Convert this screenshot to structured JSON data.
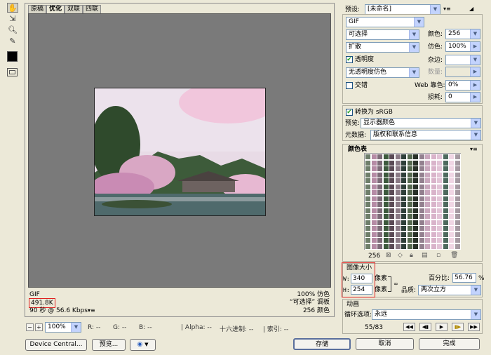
{
  "tabs": [
    "原稿",
    "优化",
    "双联",
    "四联"
  ],
  "info": {
    "format": "GIF",
    "filesize": "491.8K",
    "time": "90 秒 @ 56.6 Kbps",
    "dither_pct": "100% 仿色",
    "palette": "“可选择” 调板",
    "colors": "256  颜色"
  },
  "settings": {
    "preset_label": "预设:",
    "preset_value": "[未命名]",
    "format": "GIF",
    "reduction": "可选择",
    "dither_algo": "扩散",
    "transparency_label": "透明度",
    "matte_dither": "无透明度仿色",
    "interlaced_label": "交错",
    "colors_label": "颜色:",
    "colors_value": "256",
    "dither_label": "仿色:",
    "dither_value": "100%",
    "matte_label": "杂边:",
    "amount_label": "数量:",
    "web_snap_label": "Web 靠色:",
    "web_snap_value": "0%",
    "lossy_label": "损耗:",
    "lossy_value": "0",
    "convert_label": "转换为 sRGB",
    "preview_label": "预览:",
    "preview_value": "显示器颜色",
    "metadata_label": "元数据:",
    "metadata_value": "版权和联系信息"
  },
  "color_table": {
    "title": "颜色表",
    "count": "256"
  },
  "image_size": {
    "title": "图像大小",
    "w_label": "W:",
    "w_value": "340",
    "h_label": "H:",
    "h_value": "254",
    "unit": "像素",
    "percent_label": "百分比:",
    "percent_value": "56.76",
    "percent_unit": "%",
    "quality_label": "品质:",
    "quality_value": "两次立方"
  },
  "animation": {
    "title": "动画",
    "loop_label": "循环选项:",
    "loop_value": "永远",
    "frame": "55/83"
  },
  "statusbar": {
    "zoom": "100%",
    "r": "R: --",
    "g": "G: --",
    "b": "B: --",
    "alpha": "Alpha: --",
    "hex": "十六进制: --",
    "index": "索引: --"
  },
  "buttons": {
    "device_central": "Device Central...",
    "preview": "预览...",
    "save": "存储",
    "cancel": "取消",
    "done": "完成"
  },
  "colors": {
    "highlight": "#e02020",
    "canvas_bg": "#7a7a7a"
  }
}
